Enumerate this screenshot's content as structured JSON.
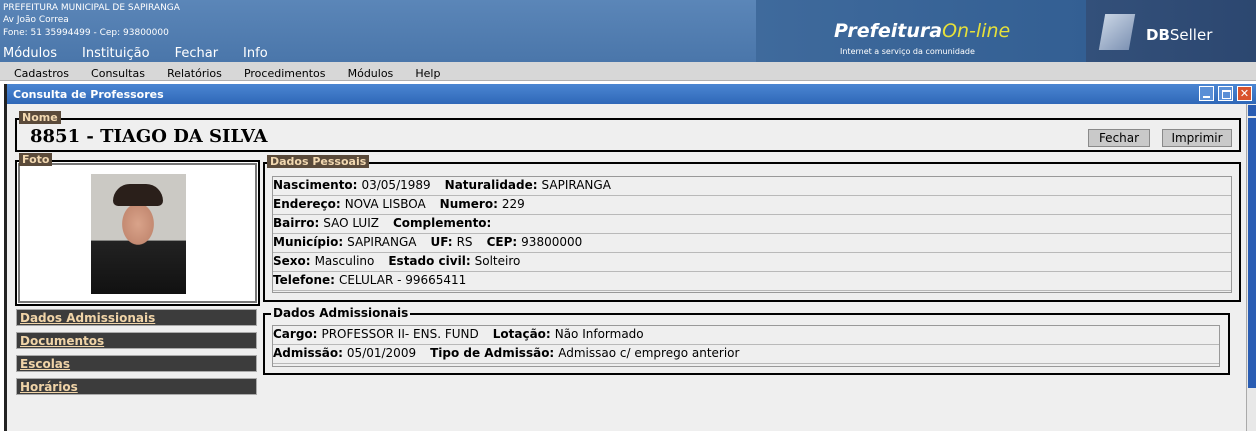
{
  "header": {
    "org": "PREFEITURA MUNICIPAL DE SAPIRANGA",
    "address": "Av João Correa",
    "contact": "Fone: 51 35994499  -  Cep: 93800000",
    "menu": [
      "Módulos",
      "Instituição",
      "Fechar",
      "Info"
    ],
    "brand_main": "Prefeitura",
    "brand_on": "On-line",
    "brand_tagline": "Internet a serviço da comunidade",
    "company_a": "DB",
    "company_b": "Seller"
  },
  "menubar": [
    "Cadastros",
    "Consultas",
    "Relatórios",
    "Procedimentos",
    "Módulos",
    "Help"
  ],
  "window": {
    "title": "Consulta de Professores",
    "close_glyph": "✕"
  },
  "nome": {
    "legend": "Nome",
    "value": "8851  -  TIAGO DA SILVA",
    "btn_close": "Fechar",
    "btn_print": "Imprimir"
  },
  "foto": {
    "legend": "Foto"
  },
  "side_links": [
    "Dados Admissionais",
    "Documentos",
    "Escolas",
    "Horários"
  ],
  "pessoais": {
    "legend": "Dados Pessoais",
    "rows": [
      [
        [
          "Nascimento:",
          "03/05/1989"
        ],
        [
          "Naturalidade:",
          "SAPIRANGA"
        ]
      ],
      [
        [
          "Endereço:",
          "NOVA LISBOA"
        ],
        [
          "Numero:",
          "229"
        ]
      ],
      [
        [
          "Bairro:",
          "SAO LUIZ"
        ],
        [
          "Complemento:",
          ""
        ]
      ],
      [
        [
          "Município:",
          "SAPIRANGA"
        ],
        [
          "UF:",
          "RS"
        ],
        [
          "CEP:",
          "93800000"
        ]
      ],
      [
        [
          "Sexo:",
          "Masculino"
        ],
        [
          "Estado civil:",
          "Solteiro"
        ]
      ],
      [
        [
          "Telefone:",
          "CELULAR - 99665411"
        ]
      ]
    ]
  },
  "admissionais": {
    "legend": "Dados Admissionais",
    "rows": [
      [
        [
          "Cargo:",
          "PROFESSOR II- ENS. FUND"
        ],
        [
          "Lotação:",
          "Não Informado"
        ]
      ],
      [
        [
          "Admissão:",
          "05/01/2009"
        ],
        [
          "Tipo de Admissão:",
          "Admissao c/ emprego anterior"
        ]
      ]
    ]
  }
}
